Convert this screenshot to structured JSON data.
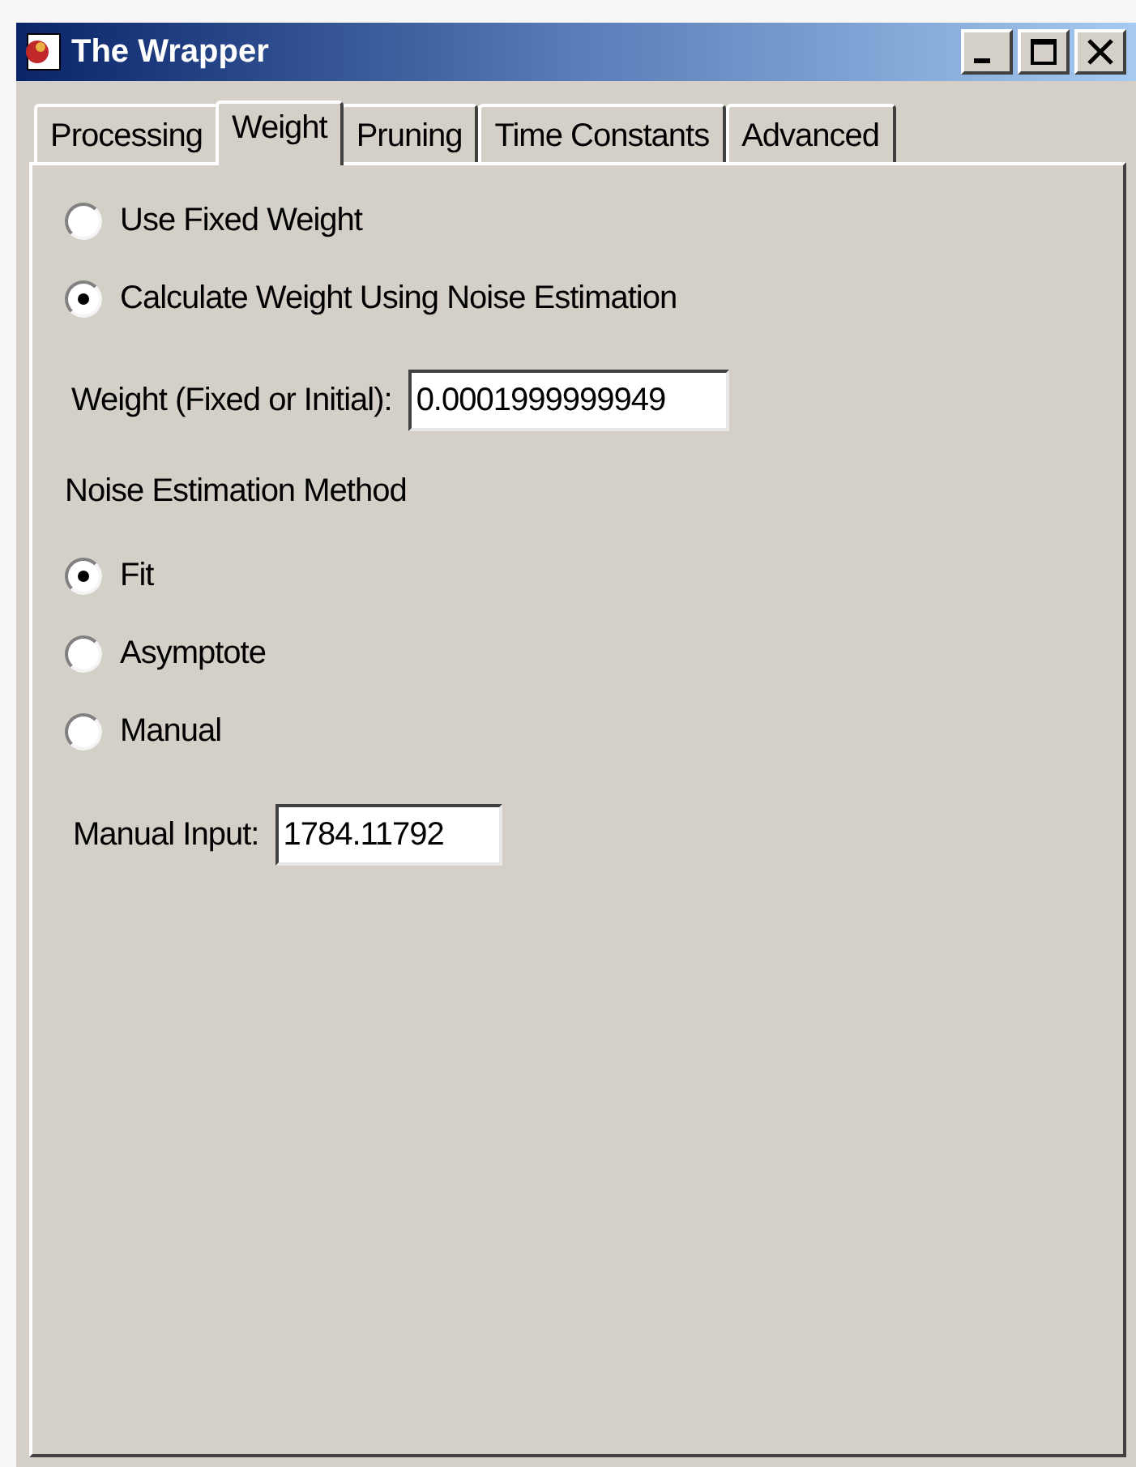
{
  "window": {
    "title": "The Wrapper"
  },
  "tabs": [
    {
      "label": "Processing",
      "selected": false
    },
    {
      "label": "Weight",
      "selected": true
    },
    {
      "label": "Pruning",
      "selected": false
    },
    {
      "label": "Time Constants",
      "selected": false
    },
    {
      "label": "Advanced",
      "selected": false
    }
  ],
  "weight_mode": [
    {
      "label": "Use Fixed Weight",
      "selected": false
    },
    {
      "label": "Calculate Weight Using Noise Estimation",
      "selected": true
    }
  ],
  "weight_field": {
    "label": "Weight (Fixed or Initial):",
    "value": "0.0001999999949"
  },
  "noise_method": {
    "heading": "Noise Estimation Method",
    "options": [
      {
        "label": "Fit",
        "selected": true
      },
      {
        "label": "Asymptote",
        "selected": false
      },
      {
        "label": "Manual",
        "selected": false
      }
    ]
  },
  "manual_field": {
    "label": "Manual Input:",
    "value": "1784.11792"
  }
}
